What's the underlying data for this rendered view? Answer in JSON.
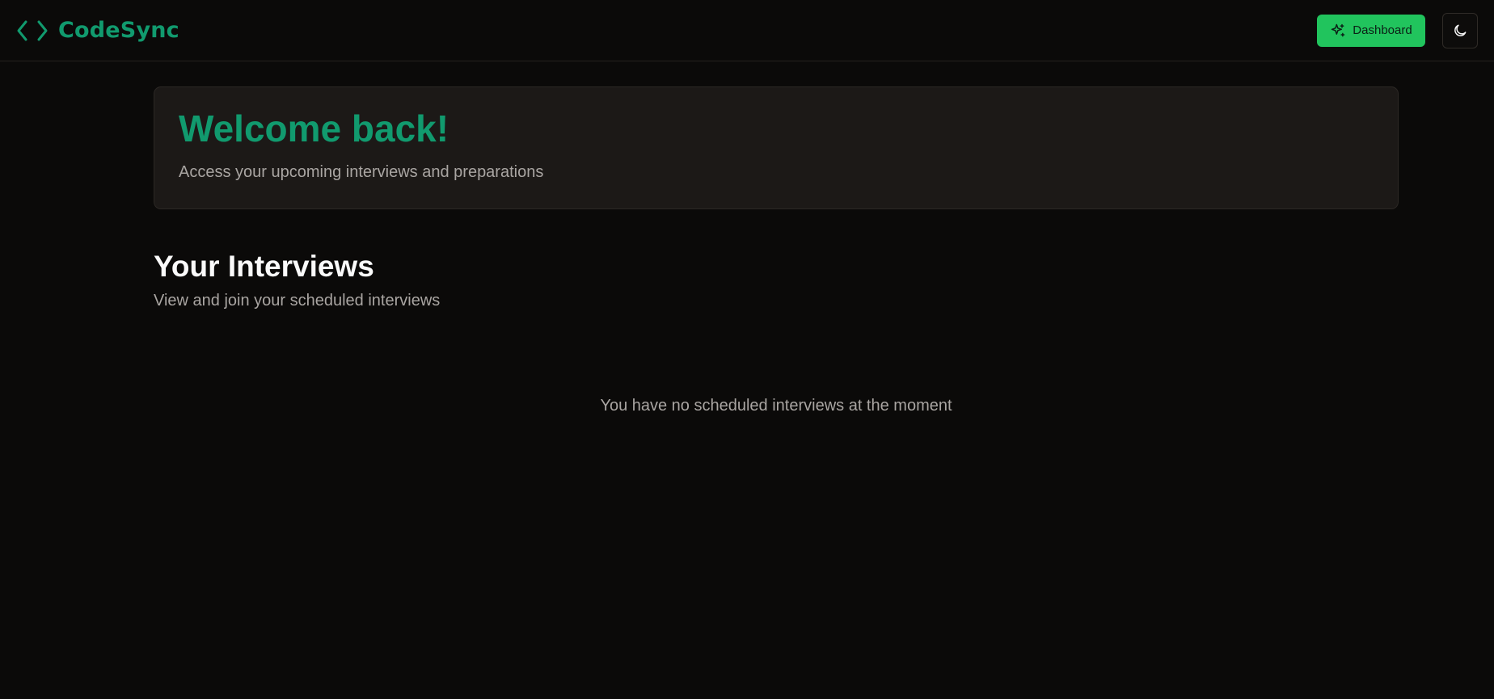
{
  "app": {
    "brand_name": "CodeSync",
    "brand_icon": "code-brackets-icon",
    "accent_color": "#119a6e",
    "button_color": "#21c45d"
  },
  "navbar": {
    "dashboard_label": "Dashboard",
    "dashboard_icon": "sparkles-icon",
    "theme_icon": "moon-icon"
  },
  "welcome": {
    "title": "Welcome back!",
    "subtitle": "Access your upcoming interviews and preparations"
  },
  "interviews": {
    "title": "Your Interviews",
    "subtitle": "View and join your scheduled interviews",
    "empty_message": "You have no scheduled interviews at the moment"
  }
}
